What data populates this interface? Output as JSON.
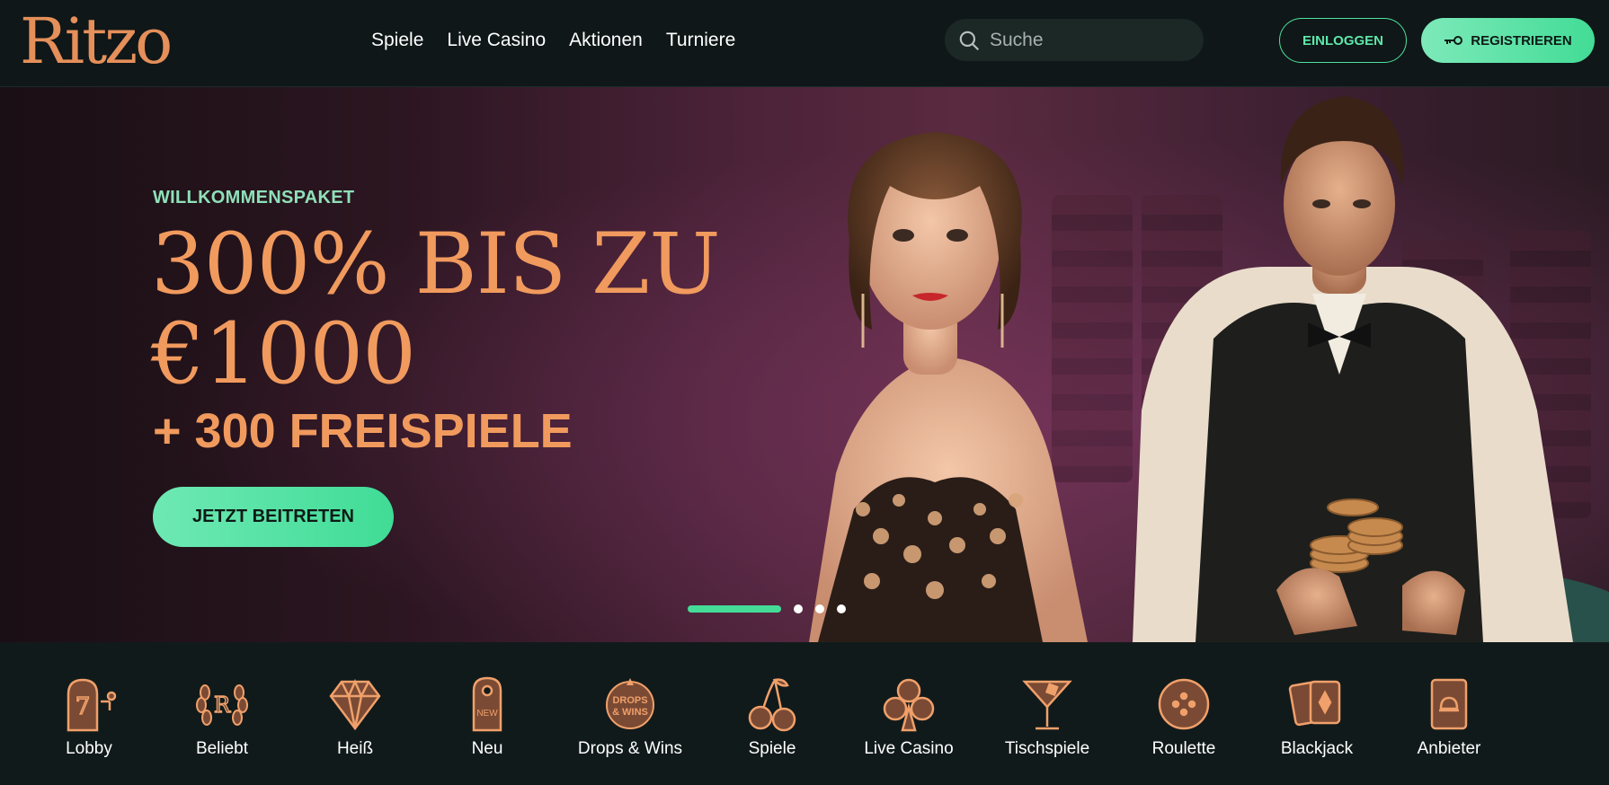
{
  "header": {
    "logo": "Ritzo",
    "nav": [
      "Spiele",
      "Live Casino",
      "Aktionen",
      "Turniere"
    ],
    "search_placeholder": "Suche",
    "login_label": "EINLOGGEN",
    "register_label": "REGISTRIEREN"
  },
  "hero": {
    "eyebrow": "WILLKOMMENSPAKET",
    "headline_line1": "300% BIS ZU",
    "headline_line2": "€1000",
    "sub": "+ 300 FREISPIELE",
    "cta": "JETZT BEITRETEN",
    "slides_total": 4,
    "slide_active": 1
  },
  "categories": [
    {
      "label": "Lobby",
      "icon": "slot-machine-icon"
    },
    {
      "label": "Beliebt",
      "icon": "laurel-r-icon"
    },
    {
      "label": "Heiß",
      "icon": "diamond-icon"
    },
    {
      "label": "Neu",
      "icon": "new-tag-icon"
    },
    {
      "label": "Drops & Wins",
      "icon": "drops-wins-icon",
      "icon_text": "DROPS & WINS"
    },
    {
      "label": "Spiele",
      "icon": "cherries-icon"
    },
    {
      "label": "Live Casino",
      "icon": "club-icon"
    },
    {
      "label": "Tischspiele",
      "icon": "cocktail-icon"
    },
    {
      "label": "Roulette",
      "icon": "roulette-chip-icon"
    },
    {
      "label": "Blackjack",
      "icon": "cards-icon"
    },
    {
      "label": "Anbieter",
      "icon": "provider-icon"
    }
  ],
  "colors": {
    "accent_green": "#45dc98",
    "accent_orange": "#f19a5e",
    "background": "#101818"
  }
}
